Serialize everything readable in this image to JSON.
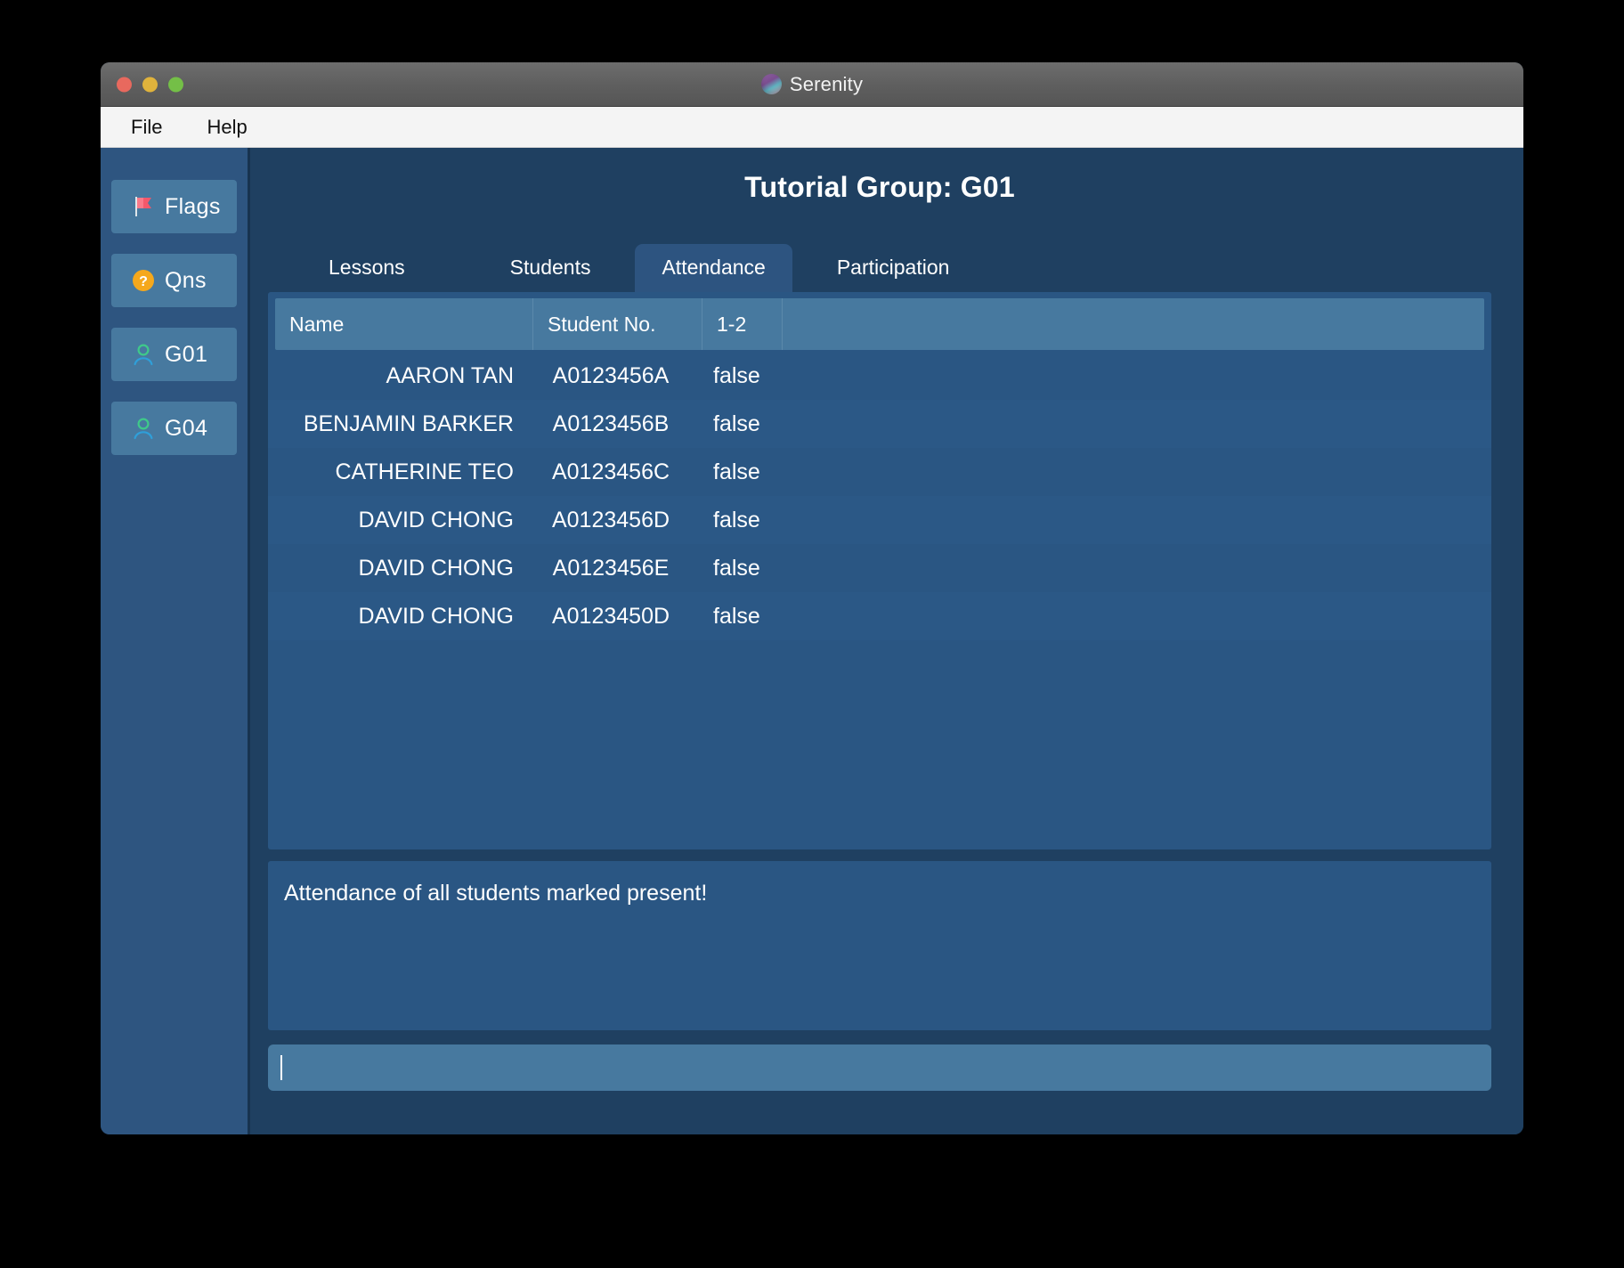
{
  "window": {
    "title": "Serenity",
    "logo_icon": "serenity-logo-icon",
    "traffic_lights": {
      "close": "close-window-button",
      "minimize": "minimize-window-button",
      "maximize": "maximize-window-button"
    }
  },
  "menubar": {
    "items": [
      {
        "label": "File"
      },
      {
        "label": "Help"
      }
    ]
  },
  "sidebar": {
    "items": [
      {
        "label": "Flags",
        "icon": "flag-icon"
      },
      {
        "label": "Qns",
        "icon": "question-circle-icon"
      },
      {
        "label": "G01",
        "icon": "person-icon"
      },
      {
        "label": "G04",
        "icon": "person-icon"
      }
    ]
  },
  "main": {
    "page_title": "Tutorial Group: G01",
    "tabs": [
      {
        "label": "Lessons",
        "selected": false
      },
      {
        "label": "Students",
        "selected": false
      },
      {
        "label": "Attendance",
        "selected": true
      },
      {
        "label": "Participation",
        "selected": false
      }
    ],
    "table": {
      "columns": [
        "Name",
        "Student No.",
        "1-2"
      ],
      "rows": [
        {
          "name": "AARON TAN",
          "student_no": "A0123456A",
          "attendance": "false"
        },
        {
          "name": "BENJAMIN BARKER",
          "student_no": "A0123456B",
          "attendance": "false"
        },
        {
          "name": "CATHERINE TEO",
          "student_no": "A0123456C",
          "attendance": "false"
        },
        {
          "name": "DAVID CHONG",
          "student_no": "A0123456D",
          "attendance": "false"
        },
        {
          "name": "DAVID CHONG",
          "student_no": "A0123456E",
          "attendance": "false"
        },
        {
          "name": "DAVID CHONG",
          "student_no": "A0123450D",
          "attendance": "false"
        }
      ]
    },
    "result": {
      "message": "Attendance of all students marked present!"
    },
    "command": {
      "value": "",
      "placeholder": ""
    }
  },
  "colors": {
    "window_bg": "#1f4061",
    "sidebar_bg": "#2e5580",
    "sidebar_item_bg": "#47799f",
    "table_bg": "#2a5683",
    "table_header_bg": "#47799f",
    "tab_selected_bg": "#2d5480",
    "input_bg": "#47799f",
    "text": "#ffffff",
    "flag_red": "#f4586b",
    "question_yellow": "#f5a81c",
    "person_green": "#3fc98a",
    "person_blue": "#2f9fd9",
    "titlebar_gray": "#5e5e5e",
    "menubar_gray": "#f4f4f4"
  }
}
